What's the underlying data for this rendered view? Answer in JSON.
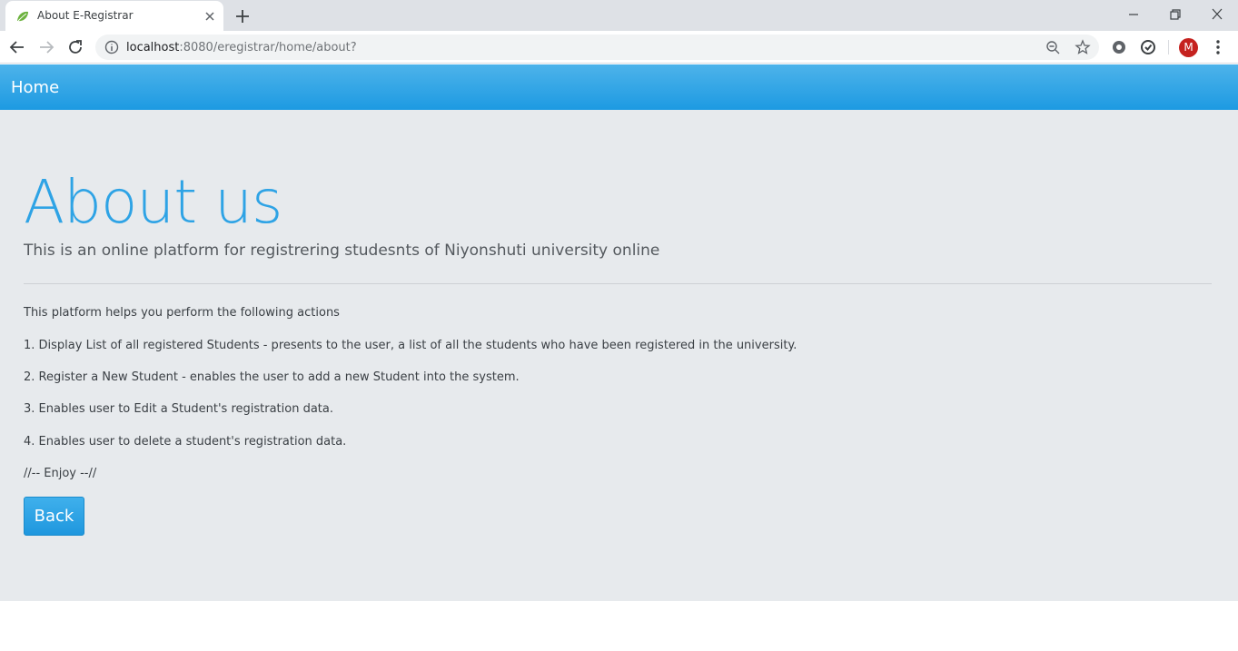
{
  "browser": {
    "tab": {
      "title": "About E-Registrar",
      "favicon": "spring-leaf-icon"
    },
    "url": {
      "host": "localhost",
      "rest": ":8080/eregistrar/home/about?"
    },
    "profile_initial": "M",
    "icons": [
      "back-arrow-icon",
      "forward-arrow-icon",
      "reload-icon",
      "info-icon",
      "zoom-out-icon",
      "star-icon",
      "extension-icon",
      "sync-icon",
      "kebab-menu-icon",
      "close-icon",
      "plus-icon",
      "minimize-icon",
      "restore-icon"
    ]
  },
  "colors": {
    "navbar": "#1d9ae2",
    "title": "#2ea3e5",
    "jumbotron_bg": "#e7eaed",
    "button": "#1f97de"
  },
  "navbar": {
    "brand": "Home"
  },
  "content": {
    "title": "About us",
    "lead": "This is an online platform for registrering studesnts of Niyonshuti university online",
    "intro": "This platform helps you perform the following actions",
    "items": [
      "1. Display List of all registered Students - presents to the user, a list of all the students who have been registered in the university.",
      "2. Register a New Student - enables the user to add a new Student into the system.",
      "3. Enables user to Edit a Student's registration data.",
      "4. Enables user to delete a student's registration data."
    ],
    "closing": "//-- Enjoy --//",
    "back_label": "Back"
  }
}
